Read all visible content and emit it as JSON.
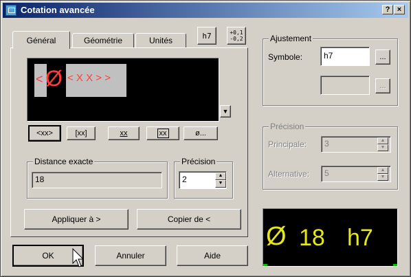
{
  "title": "Cotation avancée",
  "titlebar": {
    "help_label": "?",
    "close_label": "×"
  },
  "tabs": [
    {
      "label": "Général"
    },
    {
      "label": "Géométrie"
    },
    {
      "label": "Unités"
    }
  ],
  "tolerance_buttons": {
    "h7_label": "h7",
    "plusminus_label": "+0,1\n-0,2"
  },
  "text_editor": {
    "symbol": "Ø",
    "left": "<",
    "middle": "< X X > >"
  },
  "format_buttons": [
    {
      "label": "<xx>"
    },
    {
      "label": "[xx]"
    },
    {
      "label": "xx"
    },
    {
      "label": "xx"
    },
    {
      "label": "ø..."
    }
  ],
  "distance": {
    "legend": "Distance exacte",
    "value": "18"
  },
  "precision_small": {
    "legend": "Précision",
    "value": "2"
  },
  "actions": {
    "apply_label": "Appliquer à >",
    "copy_label": "Copier de <"
  },
  "dialog_buttons": {
    "ok": "OK",
    "cancel": "Annuler",
    "help": "Aide"
  },
  "ajustement": {
    "legend": "Ajustement",
    "symbol_label": "Symbole:",
    "symbol_value": "h7",
    "browse_label": "..."
  },
  "precision": {
    "legend": "Précision",
    "principale_label": "Principale:",
    "principale_value": "3",
    "alternative_label": "Alternative:",
    "alternative_value": "5"
  },
  "preview": {
    "symbol": "Ø",
    "value": "18",
    "tol": "h7",
    "text_color": "#e6e619"
  },
  "colors": {
    "editor_text": "#ff3c3c",
    "editor_highlight": "#c0c0c0"
  }
}
